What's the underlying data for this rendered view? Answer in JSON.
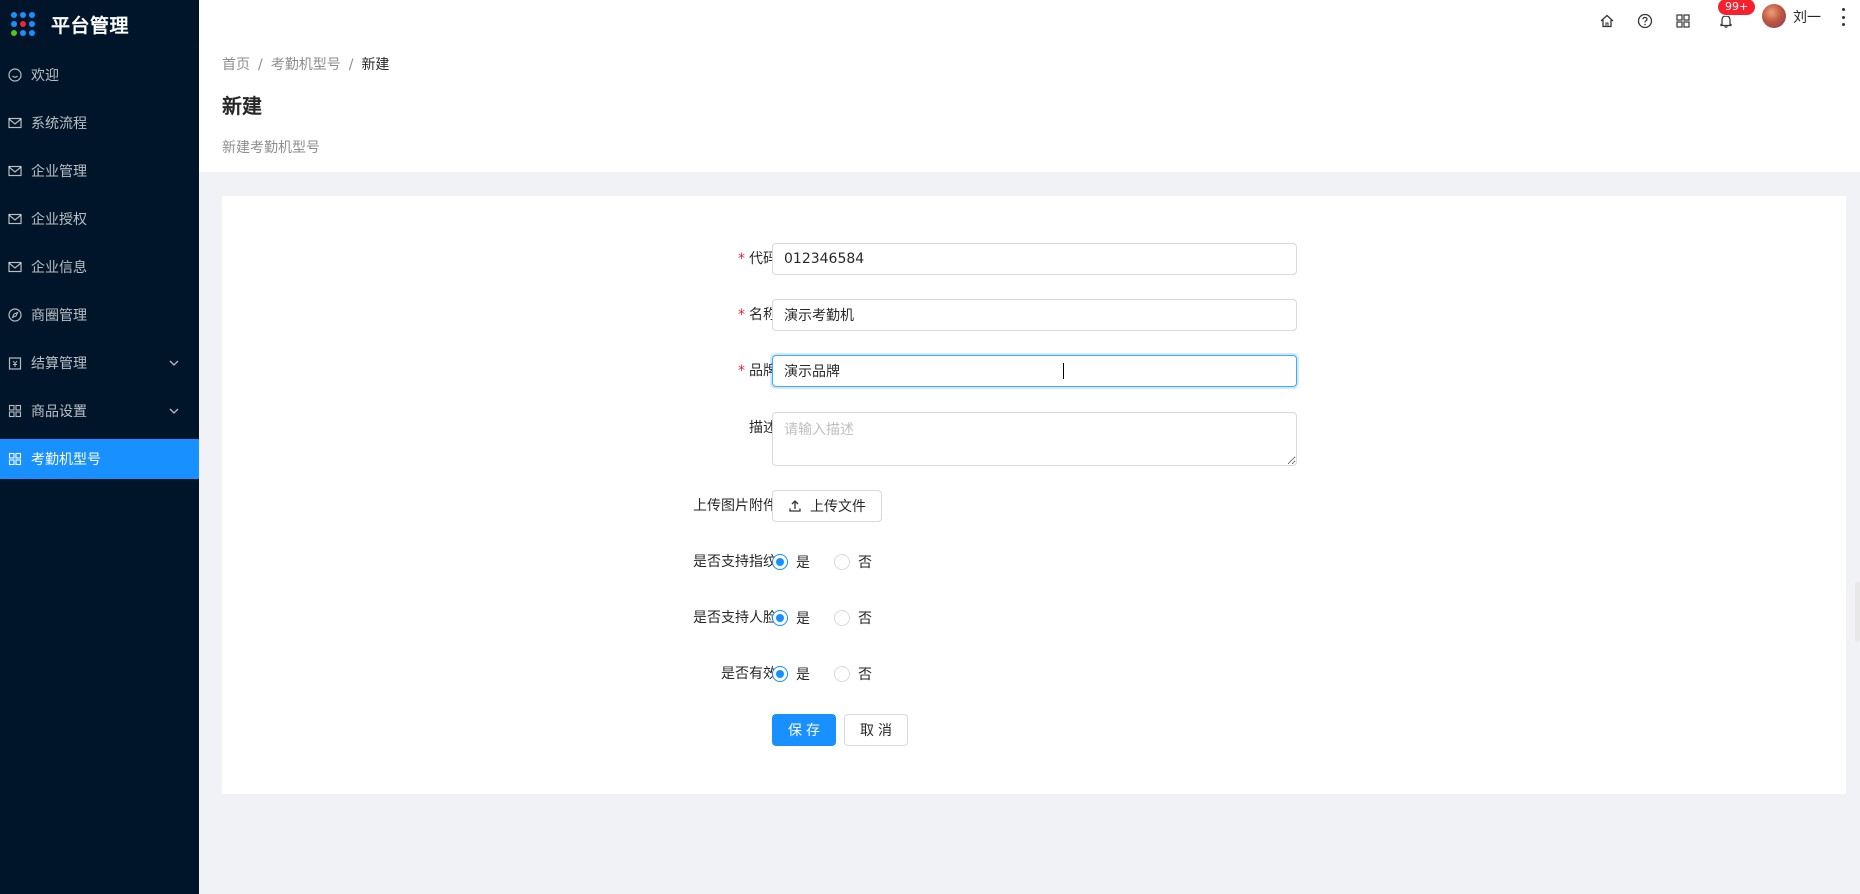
{
  "app": {
    "title": "平台管理"
  },
  "sidebar": {
    "items": [
      {
        "label": "欢迎",
        "icon": "smile-icon"
      },
      {
        "label": "系统流程",
        "icon": "mail-icon"
      },
      {
        "label": "企业管理",
        "icon": "mail-icon"
      },
      {
        "label": "企业授权",
        "icon": "mail-icon"
      },
      {
        "label": "企业信息",
        "icon": "mail-icon"
      },
      {
        "label": "商圈管理",
        "icon": "compass-icon"
      },
      {
        "label": "结算管理",
        "icon": "account-book-icon",
        "expandable": true
      },
      {
        "label": "商品设置",
        "icon": "appstore-icon",
        "expandable": true
      },
      {
        "label": "考勤机型号",
        "icon": "appstore-icon",
        "active": true
      }
    ]
  },
  "header": {
    "notification_badge": "99+",
    "username": "刘一"
  },
  "breadcrumb": {
    "home": "首页",
    "parent": "考勤机型号",
    "current": "新建"
  },
  "page": {
    "title": "新建",
    "description": "新建考勤机型号"
  },
  "form": {
    "code": {
      "label": "代码",
      "value": "012346584"
    },
    "name": {
      "label": "名称",
      "value": "演示考勤机"
    },
    "brand": {
      "label": "品牌",
      "value": "演示品牌"
    },
    "desc": {
      "label": "描述",
      "placeholder": "请输入描述"
    },
    "upload": {
      "label": "上传图片附件",
      "button": "上传文件"
    },
    "fingerprint": {
      "label": "是否支持指纹",
      "yes": "是",
      "no": "否",
      "selected": "是"
    },
    "face": {
      "label": "是否支持人脸",
      "yes": "是",
      "no": "否",
      "selected": "是"
    },
    "valid": {
      "label": "是否有效",
      "yes": "是",
      "no": "否",
      "selected": "是"
    },
    "save": "保存",
    "cancel": "取消"
  },
  "colors": {
    "primary": "#1890ff",
    "sider": "#001529",
    "required": "#f5222d",
    "badge": "#f5222d"
  }
}
